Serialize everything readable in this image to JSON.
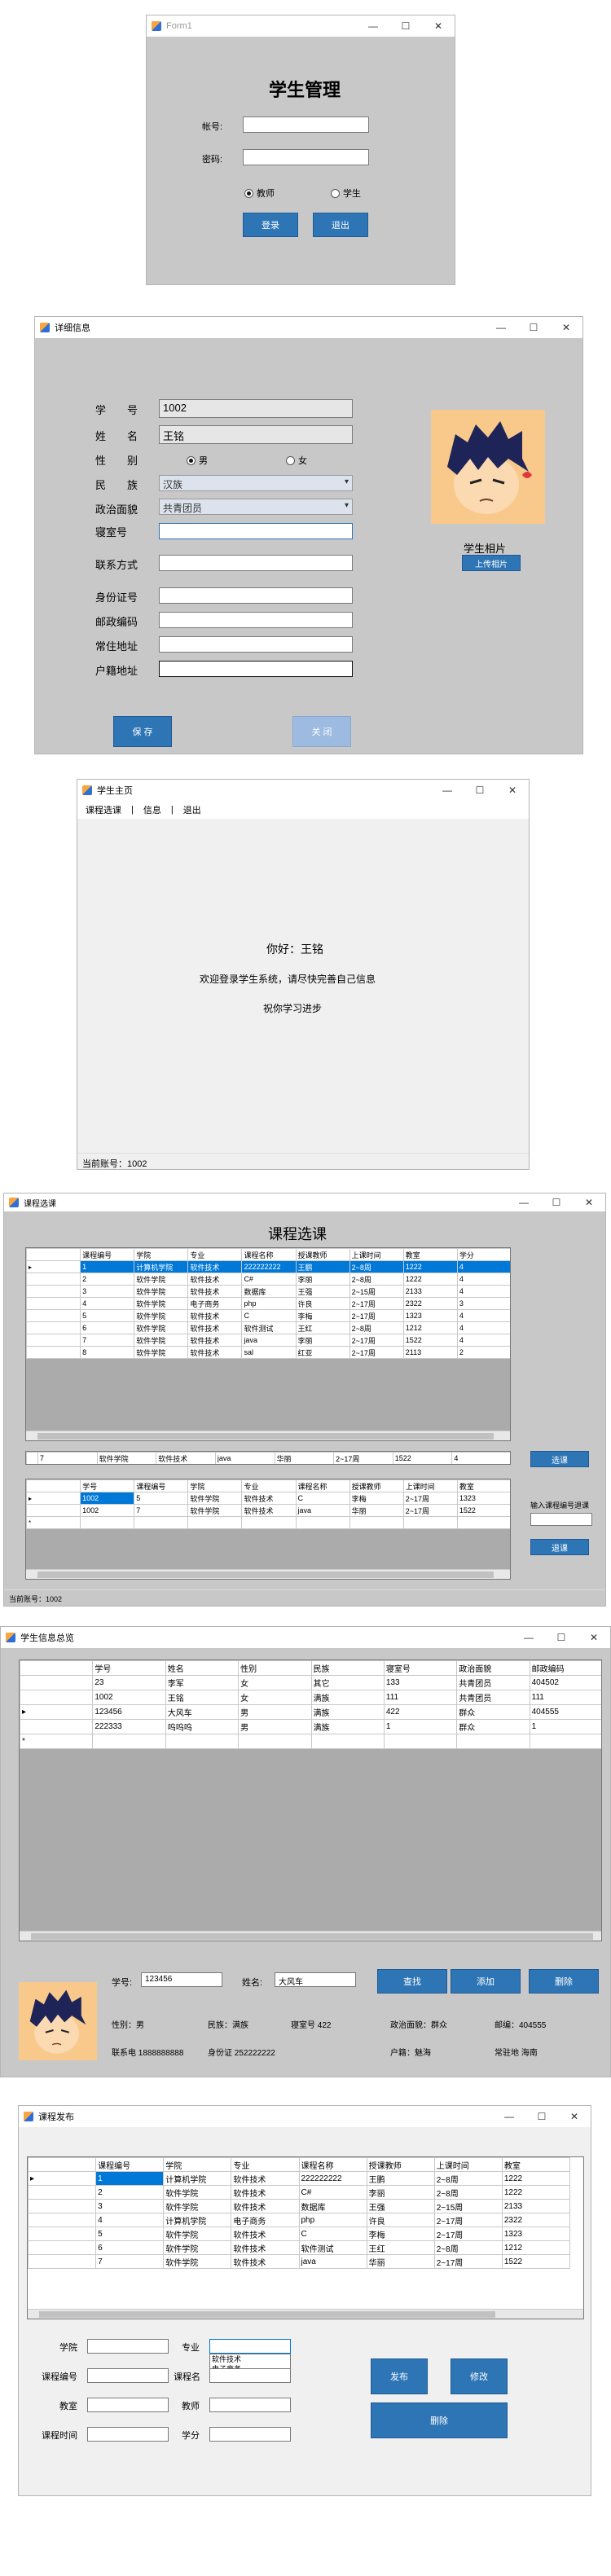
{
  "login": {
    "title": "Form1",
    "heading": "学生管理",
    "account_label": "帐号:",
    "password_label": "密码:",
    "radio_teacher": "教师",
    "radio_student": "学生",
    "login_btn": "登录",
    "exit_btn": "退出",
    "ctrl_min": "—",
    "ctrl_max": "☐",
    "ctrl_close": "✕"
  },
  "detail": {
    "title": "详细信息",
    "labels": {
      "id": "学　　号",
      "name": "姓　　名",
      "gender": "性　　别",
      "ethnic": "民　　族",
      "political": "政治面貌",
      "dorm": "寝室号",
      "contact": "联系方式",
      "idcard": "身份证号",
      "postal": "邮政编码",
      "address": "常住地址",
      "household": "户籍地址"
    },
    "values": {
      "id": "1002",
      "name": "王铭",
      "male": "男",
      "female": "女",
      "ethnic": "汉族",
      "political": "共青团员"
    },
    "photo_label": "学生相片",
    "upload_btn": "上传相片",
    "save_btn": "保 存",
    "close_btn": "关 闭"
  },
  "home": {
    "title": "学生主页",
    "menu": [
      "课程选课",
      "|",
      "信息",
      "|",
      "退出"
    ],
    "greeting": "你好：王铭",
    "welcome": "欢迎登录学生系统，请尽快完善自己信息",
    "wish": "祝你学习进步",
    "status": "当前账号：1002"
  },
  "select": {
    "title": "课程选课",
    "heading": "课程选课",
    "columns": [
      "课程编号",
      "学院",
      "专业",
      "课程名称",
      "授课教师",
      "上课时间",
      "教室",
      "学分"
    ],
    "rows": [
      [
        "1",
        "计算机学院",
        "软件技术",
        "222222222",
        "王鹏",
        "2~8周",
        "1222",
        "4"
      ],
      [
        "2",
        "软件学院",
        "软件技术",
        "C#",
        "李丽",
        "2~8周",
        "1222",
        "4"
      ],
      [
        "3",
        "软件学院",
        "软件技术",
        "数据库",
        "王强",
        "2~15周",
        "2133",
        "4"
      ],
      [
        "4",
        "软件学院",
        "电子商务",
        "php",
        "许良",
        "2~17周",
        "2322",
        "3"
      ],
      [
        "5",
        "软件学院",
        "软件技术",
        "C",
        "李梅",
        "2~17周",
        "1323",
        "4"
      ],
      [
        "6",
        "软件学院",
        "软件技术",
        "软件测试",
        "王红",
        "2~8周",
        "1212",
        "4"
      ],
      [
        "7",
        "软件学院",
        "软件技术",
        "java",
        "李丽",
        "2~17周",
        "1522",
        "4"
      ],
      [
        "8",
        "软件学院",
        "软件技术",
        "sal",
        "红亚",
        "2~17周",
        "2113",
        "2"
      ]
    ],
    "picked_row": [
      "7",
      "软件学院",
      "软件技术",
      "java",
      "华丽",
      "2~17周",
      "1522",
      "4"
    ],
    "select_btn": "选课",
    "my_columns": [
      "学号",
      "课程编号",
      "学院",
      "专业",
      "课程名称",
      "授课教师",
      "上课时间",
      "教室"
    ],
    "my_rows": [
      [
        "1002",
        "5",
        "软件学院",
        "软件技术",
        "C",
        "李梅",
        "2~17周",
        "1323"
      ],
      [
        "1002",
        "7",
        "软件学院",
        "软件技术",
        "java",
        "华丽",
        "2~17周",
        "1522"
      ]
    ],
    "drop_label": "输入课程编号退课",
    "drop_btn": "退课",
    "status": "当前账号：1002"
  },
  "summary": {
    "title": "学生信息总览",
    "columns": [
      "学号",
      "姓名",
      "性别",
      "民族",
      "寝室号",
      "政治面貌",
      "邮政编码"
    ],
    "rows": [
      [
        "23",
        "李军",
        "女",
        "其它",
        "133",
        "共青团员",
        "404502"
      ],
      [
        "1002",
        "王铭",
        "女",
        "满族",
        "111",
        "共青团员",
        "111"
      ],
      [
        "123456",
        "大风车",
        "男",
        "满族",
        "422",
        "群众",
        "404555"
      ],
      [
        "222333",
        "呜呜呜",
        "男",
        "满族",
        "1",
        "群众",
        "1"
      ]
    ],
    "id_label": "学号:",
    "id_value": "123456",
    "name_label": "姓名:",
    "name_value": "大风车",
    "search_btn": "查找",
    "add_btn": "添加",
    "del_btn": "删除",
    "gender": "性别：男",
    "ethnic": "民族：满族",
    "dorm": "寝室号 422",
    "political": "政治面貌：群众",
    "postal": "邮编：404555",
    "phone": "联系电 1888888888",
    "idcard": "身份证 252222222",
    "household": "户籍：魅海",
    "address": "常驻地 海南"
  },
  "publish": {
    "title": "课程发布",
    "columns": [
      "课程编号",
      "学院",
      "专业",
      "课程名称",
      "授课教师",
      "上课时间",
      "教室"
    ],
    "rows": [
      [
        "1",
        "计算机学院",
        "软件技术",
        "222222222",
        "王鹏",
        "2~8周",
        "1222"
      ],
      [
        "2",
        "软件学院",
        "软件技术",
        "C#",
        "李丽",
        "2~8周",
        "1222"
      ],
      [
        "3",
        "软件学院",
        "软件技术",
        "数据库",
        "王强",
        "2~15周",
        "2133"
      ],
      [
        "4",
        "计算机学院",
        "电子商务",
        "php",
        "许良",
        "2~17周",
        "2322"
      ],
      [
        "5",
        "软件学院",
        "软件技术",
        "C",
        "李梅",
        "2~17周",
        "1323"
      ],
      [
        "6",
        "软件学院",
        "软件技术",
        "软件测试",
        "王红",
        "2~8周",
        "1212"
      ],
      [
        "7",
        "软件学院",
        "软件技术",
        "java",
        "华丽",
        "2~17周",
        "1522"
      ]
    ],
    "labels": {
      "college": "学院",
      "major": "专业",
      "course_id": "课程编号",
      "course_name": "课程名",
      "room": "教室",
      "teacher": "教师",
      "time": "课程时间",
      "credit": "学分"
    },
    "major_options": [
      "软件技术",
      "电子商务"
    ],
    "publish_btn": "发布",
    "modify_btn": "修改",
    "delete_btn": "删除"
  }
}
